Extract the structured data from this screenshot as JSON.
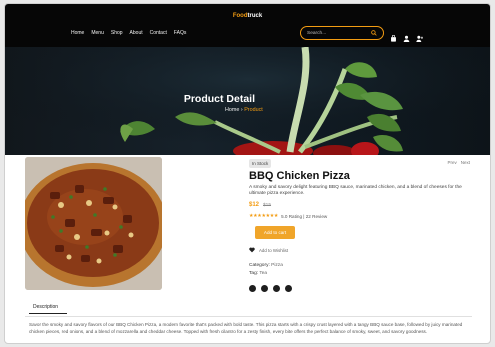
{
  "brand": {
    "part1": "Food",
    "part2": "truck",
    "accent_color": "#f39c12"
  },
  "nav": {
    "menu": [
      "Home",
      "Menu",
      "Shop",
      "About",
      "Contact",
      "FAQs"
    ],
    "search_placeholder": "Search...",
    "icons": [
      "search-icon",
      "bag-icon",
      "user-icon",
      "user-add-icon"
    ]
  },
  "banner": {
    "title": "Product Detail",
    "crumb_home": "Home",
    "crumb_sep": " › ",
    "crumb_current": "Product"
  },
  "product": {
    "stock": "In Stock",
    "nav_prev": "Prev",
    "nav_next": "Next",
    "title": "BBQ Chicken Pizza",
    "description": "A smoky and savory delight featuring BBQ sauce, marinated chicken, and a blend of cheeses for the ultimate pizza experience.",
    "price": "$12",
    "old_price": "$15",
    "rating_value": 5.0,
    "stars": "★★★★★★★",
    "rating_text": "5.0 Rating | 22 Review",
    "add_to_cart": "Add to cart",
    "wishlist": "Add to Wishlist",
    "category_label": "Category:",
    "category_value": "Pizza",
    "tag_label": "Tag:",
    "tag_value": "Tea",
    "social_icons": [
      "facebook-icon",
      "twitter-icon",
      "instagram-icon",
      "pinterest-icon"
    ]
  },
  "tabs": {
    "description": "Description"
  },
  "description_body": "Savor the smoky and savory flavors of our BBQ Chicken Pizza, a modern favorite that's packed with bold taste. This pizza starts with a crispy crust layered with a tangy BBQ sauce base, followed by juicy marinated chicken pieces, red onions, and a blend of mozzarella and cheddar cheese. Topped with fresh cilantro for a zesty finish, every bite offers the perfect balance of smoky, sweet, and savory goodness."
}
